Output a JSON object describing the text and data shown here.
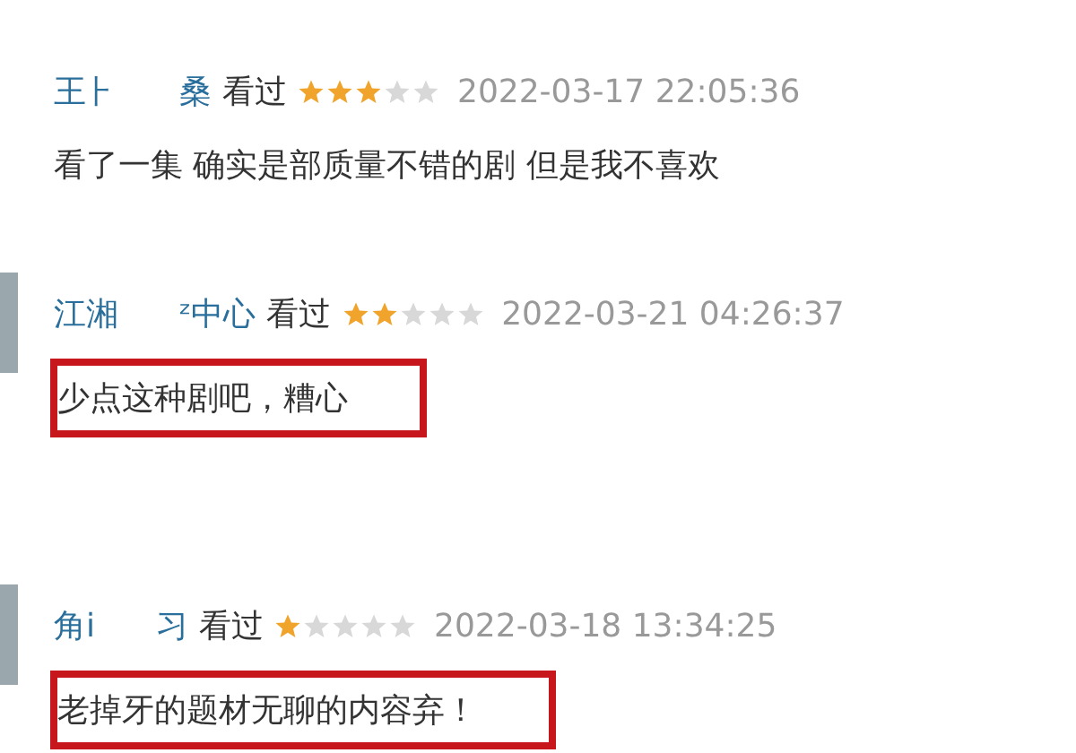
{
  "comments": [
    {
      "name_parts": [
        "王⺊",
        "桑"
      ],
      "avatar": false,
      "status": "看过",
      "stars": 3,
      "time": "2022-03-17 22:05:36",
      "text": "看了一集 确实是部质量不错的剧 但是我不喜欢",
      "highlighted": false
    },
    {
      "name_parts": [
        "江湘",
        "ᶻ中心"
      ],
      "avatar": true,
      "status": "看过",
      "stars": 2,
      "time": "2022-03-21 04:26:37",
      "text": "少点这种剧吧，糟心",
      "highlighted": true
    },
    {
      "name_parts": [
        "角i",
        "习"
      ],
      "avatar": true,
      "status": "看过",
      "stars": 1,
      "time": "2022-03-18 13:34:25",
      "text": "老掉牙的题材无聊的内容弃！",
      "highlighted": true
    }
  ]
}
